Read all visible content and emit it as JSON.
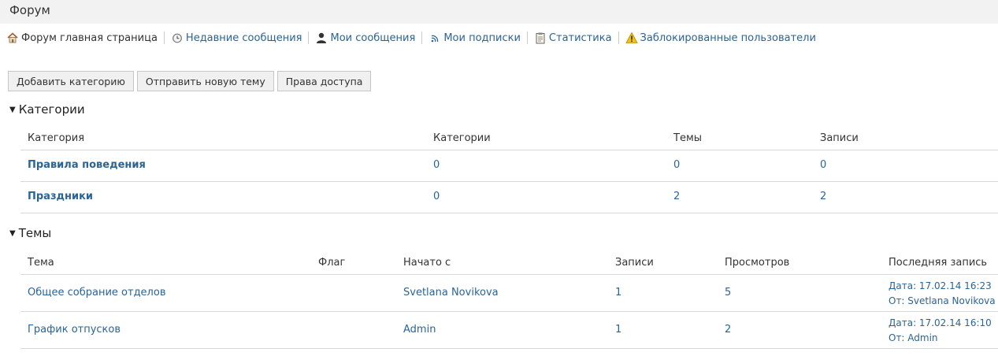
{
  "page": {
    "title": "Форум"
  },
  "nav": {
    "home": "Форум главная страница",
    "recent": "Недавние сообщения",
    "my_posts": "Мои сообщения",
    "subscriptions": "Мои подписки",
    "statistics": "Статистика",
    "blocked": "Заблокированные пользователи"
  },
  "buttons": {
    "add_category": "Добавить категорию",
    "new_topic": "Отправить новую тему",
    "permissions": "Права доступа"
  },
  "categories": {
    "heading": "Категории",
    "columns": {
      "category": "Категория",
      "subcategories": "Категории",
      "topics": "Темы",
      "posts": "Записи"
    },
    "rows": [
      {
        "name": "Правила поведения",
        "subcategories": "0",
        "topics": "0",
        "posts": "0"
      },
      {
        "name": "Праздники",
        "subcategories": "0",
        "topics": "2",
        "posts": "2"
      }
    ]
  },
  "topics": {
    "heading": "Темы",
    "columns": {
      "topic": "Тема",
      "flag": "Флаг",
      "started_by": "Начато с",
      "posts": "Записи",
      "views": "Просмотров",
      "last_post": "Последняя запись"
    },
    "rows": [
      {
        "topic": "Общее собрание отделов",
        "started_by": "Svetlana Novikova",
        "posts": "1",
        "views": "5",
        "last_date": "Дата: 17.02.14 16:23",
        "last_from": "От: Svetlana Novikova"
      },
      {
        "topic": "График отпусков",
        "started_by": "Admin",
        "posts": "1",
        "views": "2",
        "last_date": "Дата: 17.02.14 16:10",
        "last_from": "От: Admin"
      }
    ]
  },
  "icons": {
    "home": "home-icon",
    "recent": "clock-icon",
    "my_posts": "user-icon",
    "subscriptions": "rss-icon",
    "statistics": "clipboard-icon",
    "blocked": "warning-icon"
  }
}
